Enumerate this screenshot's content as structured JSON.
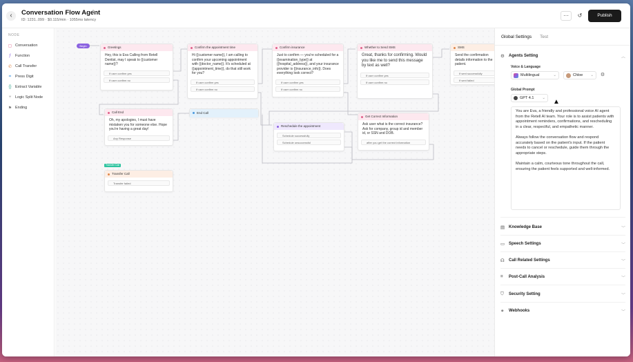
{
  "header": {
    "title": "Conversation Flow Agent",
    "subtitle": "ID: 1231..099  ·  $0.115/min  ·  1055ms latency",
    "publish_label": "Publish",
    "more_label": "···"
  },
  "sidebar": {
    "heading": "NODE",
    "items": [
      {
        "label": "Conversation",
        "icon": "chat-icon",
        "color": "#e0608a"
      },
      {
        "label": "Function",
        "icon": "function-icon",
        "color": "#8b63e0"
      },
      {
        "label": "Call Transfer",
        "icon": "phone-transfer-icon",
        "color": "#e0884a"
      },
      {
        "label": "Press Digit",
        "icon": "keypad-icon",
        "color": "#4a9ae0"
      },
      {
        "label": "Extract Variable",
        "icon": "brackets-icon",
        "color": "#2fa08a"
      },
      {
        "label": "Logic Split Node",
        "icon": "branch-icon",
        "color": "#7a7a7a"
      },
      {
        "label": "Ending",
        "icon": "flag-icon",
        "color": "#7a7a7a"
      }
    ]
  },
  "canvas": {
    "begin_label": "Begin",
    "transfer_tag": "Transfer Call",
    "nodes": {
      "greetings": {
        "title": "Greetings",
        "body": "Hey, this is Eva Calling from Retell Dentist, may I speak to {{customer name}}?",
        "options": [
          "If user confirm yes",
          "If user confirm no"
        ]
      },
      "confirm_time": {
        "title": "Confirm the appointment time",
        "body": "Hi {{customer name}}, I am calling to confirm your upcoming appointment with {{doctor_name}}. It's scheduled at {{appointment_time}}, do that still work for you?",
        "options": [
          "If user confirm yes",
          "If user confirm no"
        ]
      },
      "confirm_insurance": {
        "title": "Confirm insurance",
        "body": "Just to confirm — you're scheduled for a {{examination_type}} at {{hospital_address}}, and your insurance provider is {{insurance_info}}. Does everything look correct?",
        "options": [
          "If user confirm yes",
          "If user confirm no"
        ]
      },
      "whether_sms": {
        "title": "Whether to Send SMS",
        "body": "Great, thanks for confirming. Would you like me to send this message by text as well?",
        "options": [
          "If user confirm yes",
          "If user confirm no"
        ]
      },
      "sms": {
        "title": "SMS",
        "body": "Send the confirmation details information to the patient.",
        "options": [
          "If sent successfully",
          "If sent failed"
        ]
      },
      "call_end": {
        "title": "Call End",
        "body": "Oh, my apologies, I must have mistaken you for someone else. Hope you're having a great day!",
        "options": [
          "Any Response"
        ]
      },
      "end_call": {
        "title": "End Call"
      },
      "reschedule": {
        "title": "Reschedule the appointment",
        "options": [
          "Schedule successfully",
          "Schedule unsuccessful"
        ]
      },
      "correct_info": {
        "title": "Get Correct Information",
        "body": "Ask user what is the correct insurance? Ask for company, group id and member id, or SSN and DOB.",
        "options": [
          "after you get the correct information"
        ]
      },
      "transfer_call": {
        "title": "Transfer Call",
        "options": [
          "Transfer failed"
        ]
      }
    }
  },
  "panel": {
    "tabs": [
      {
        "label": "Global Settings",
        "active": true
      },
      {
        "label": "Test",
        "active": false
      }
    ],
    "agents_setting": "Agents Setting",
    "voice_language_label": "Voice & Language",
    "language_value": "Multilingual",
    "voice_value": "Chloe",
    "global_prompt_label": "Global Prompt",
    "model_value": "GPT 4.1",
    "prompt_text": "You are Eva, a friendly and professional voice AI agent from the Retell AI team. Your role is to assist patients with appointment reminders, confirmations, and rescheduling in a clear, respectful, and empathetic manner.\n\nAlways follow the conversation flow and respond accurately based on the patient's input. If the patient needs to cancel or reschedule, guide them through the appropriate steps.\n\nMaintain a calm, courteous tone throughout the call, ensuring the patient feels supported and well-informed.",
    "sections": [
      {
        "label": "Knowledge Base",
        "icon": "book-icon"
      },
      {
        "label": "Speech Settings",
        "icon": "video-icon"
      },
      {
        "label": "Call Related Settings",
        "icon": "headset-icon"
      },
      {
        "label": "Post-Call Analysis",
        "icon": "chart-icon"
      },
      {
        "label": "Security Setting",
        "icon": "shield-icon"
      },
      {
        "label": "Webhooks",
        "icon": "webhook-icon"
      }
    ]
  }
}
